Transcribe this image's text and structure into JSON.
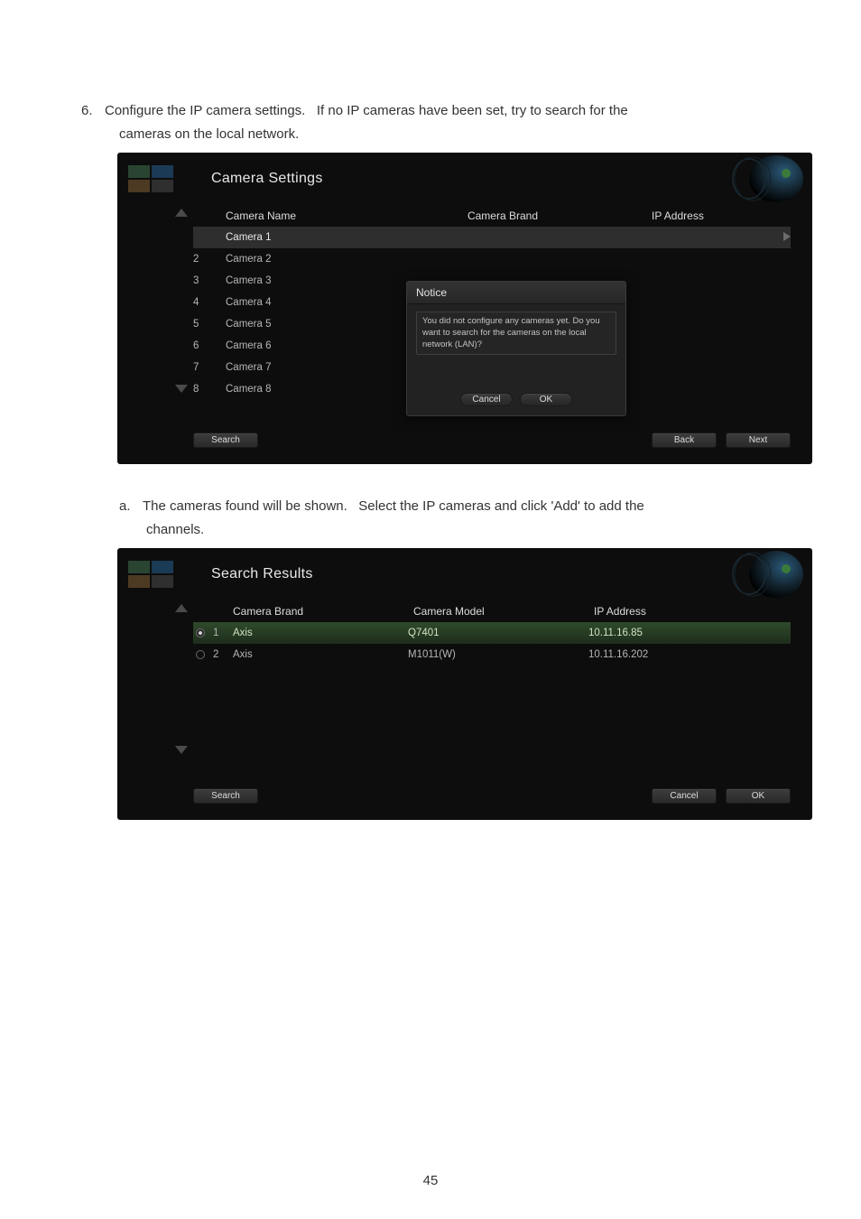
{
  "page_number": "45",
  "step6": {
    "num": "6.",
    "text_a": "Configure the IP camera settings.",
    "text_b": "If no IP cameras have been set, try to search for the",
    "text_c": "cameras on the local network."
  },
  "shot1": {
    "title": "Camera Settings",
    "headers": {
      "name": "Camera Name",
      "brand": "Camera Brand",
      "ip": "IP Address"
    },
    "rows": [
      {
        "idx": "",
        "name": "Camera 1"
      },
      {
        "idx": "2",
        "name": "Camera 2"
      },
      {
        "idx": "3",
        "name": "Camera 3"
      },
      {
        "idx": "4",
        "name": "Camera 4"
      },
      {
        "idx": "5",
        "name": "Camera 5"
      },
      {
        "idx": "6",
        "name": "Camera 6"
      },
      {
        "idx": "7",
        "name": "Camera 7"
      },
      {
        "idx": "8",
        "name": "Camera 8"
      }
    ],
    "modal": {
      "title": "Notice",
      "msg": "You did not configure any cameras yet. Do you want to search for the cameras on the local network (LAN)?",
      "cancel": "Cancel",
      "ok": "OK"
    },
    "search": "Search",
    "back": "Back",
    "next": "Next"
  },
  "stepa": {
    "num": "a.",
    "text_a": "The cameras found will be shown.",
    "text_b": "Select the IP cameras and click 'Add' to add the",
    "text_c": "channels."
  },
  "shot2": {
    "title": "Search Results",
    "headers": {
      "brand": "Camera Brand",
      "model": "Camera Model",
      "ip": "IP Address"
    },
    "rows": [
      {
        "idx": "1",
        "brand": "Axis",
        "model": "Q7401",
        "ip": "10.11.16.85",
        "sel": true
      },
      {
        "idx": "2",
        "brand": "Axis",
        "model": "M1011(W)",
        "ip": "10.11.16.202",
        "sel": false
      }
    ],
    "search": "Search",
    "cancel": "Cancel",
    "ok": "OK"
  }
}
